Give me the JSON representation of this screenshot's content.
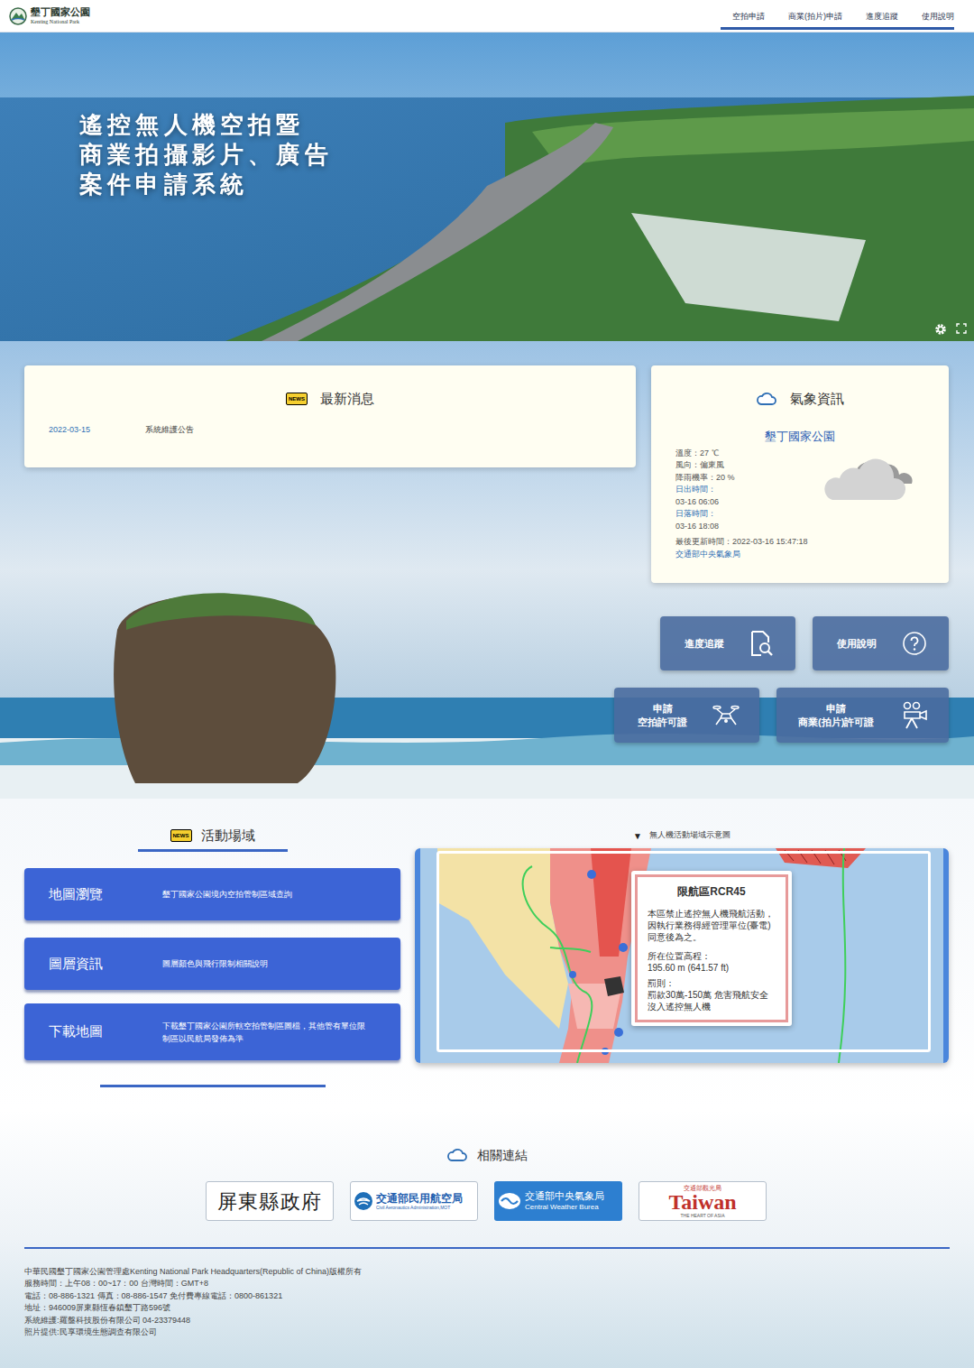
{
  "header": {
    "logo_title": "墾丁國家公園",
    "logo_subtitle": "Kenting National Park",
    "nav": [
      "空拍申請",
      "商業(拍片)申請",
      "進度追蹤",
      "使用說明"
    ]
  },
  "hero": {
    "title_lines": [
      "遙控無人機空拍暨",
      "商業拍攝影片、廣告",
      "案件申請系統"
    ]
  },
  "news": {
    "badge": "NEWS",
    "heading": "最新消息",
    "items": [
      {
        "date": "2022-03-15",
        "title": "系統維護公告"
      }
    ]
  },
  "weather": {
    "heading": "氣象資訊",
    "location": "墾丁國家公園",
    "lines": [
      "溫度：27 ℃",
      "風向：偏東風",
      "降雨機率：20 %",
      "日出時間：",
      "03-16 06:06",
      "日落時間：",
      "03-16 18:08"
    ],
    "updated": "最後更新時間：2022-03-16 15:47:18",
    "source": "交通部中央氣象局"
  },
  "quick_buttons": [
    {
      "lines": [
        "進度追蹤"
      ]
    },
    {
      "lines": [
        "使用說明"
      ]
    },
    {
      "lines": [
        "申請",
        "空拍許可證"
      ]
    },
    {
      "lines": [
        "申請",
        "商業(拍片)許可證"
      ]
    }
  ],
  "activity": {
    "badge": "NEWS",
    "heading": "活動場域",
    "buttons": [
      {
        "title": "地圖瀏覽",
        "description": "墾丁國家公園境內空拍管制區域查詢"
      },
      {
        "title": "圖層資訊",
        "description": "圖層顏色與飛行限制相關說明"
      },
      {
        "title": "下載地圖",
        "description": "下載墾丁國家公園所轄空拍管制區圖檔，其他管有單位限制區以民航局發佈為準"
      }
    ]
  },
  "map": {
    "caption_marker": "▼",
    "caption": "無人機活動場域示意圖",
    "popup": {
      "title": "限航區RCR45",
      "description": "本區禁止遙控無人機飛航活動，因執行業務得經管理單位(臺電)同意後為之。",
      "elevation_label": "所在位置高程：",
      "elevation": "195.60 m (641.57 ft)",
      "penalty_label": "罰則：",
      "penalty": "罰款30萬-150萬 危害飛航安全 沒入遙控無人機"
    }
  },
  "links": {
    "heading": "相關連結",
    "items": [
      {
        "name": "屏東縣政府"
      },
      {
        "name": "交通部民用航空局",
        "subtitle": "Civil Aeronautics Administration,MOT"
      },
      {
        "name": "交通部中央氣象局",
        "subtitle": "Central Weather Burea"
      },
      {
        "name": "交通部觀光局",
        "title": "Taiwan",
        "subtitle": "THE HEART OF ASIA"
      }
    ]
  },
  "footer": [
    "中華民國墾丁國家公園管理處Kenting National Park Headquarters(Republic of China)版權所有",
    "服務時間：上午08：00~17：00 台灣時間：GMT+8",
    "電話：08-886-1321 傳真：08-886-1547 免付費專線電話：0800-861321",
    "地址：946009屏東縣恆春鎮墾丁路596號",
    "系統維護:羅盤科技股份有限公司 04-23379448",
    "照片提供:民享環境生態調查有限公司"
  ]
}
